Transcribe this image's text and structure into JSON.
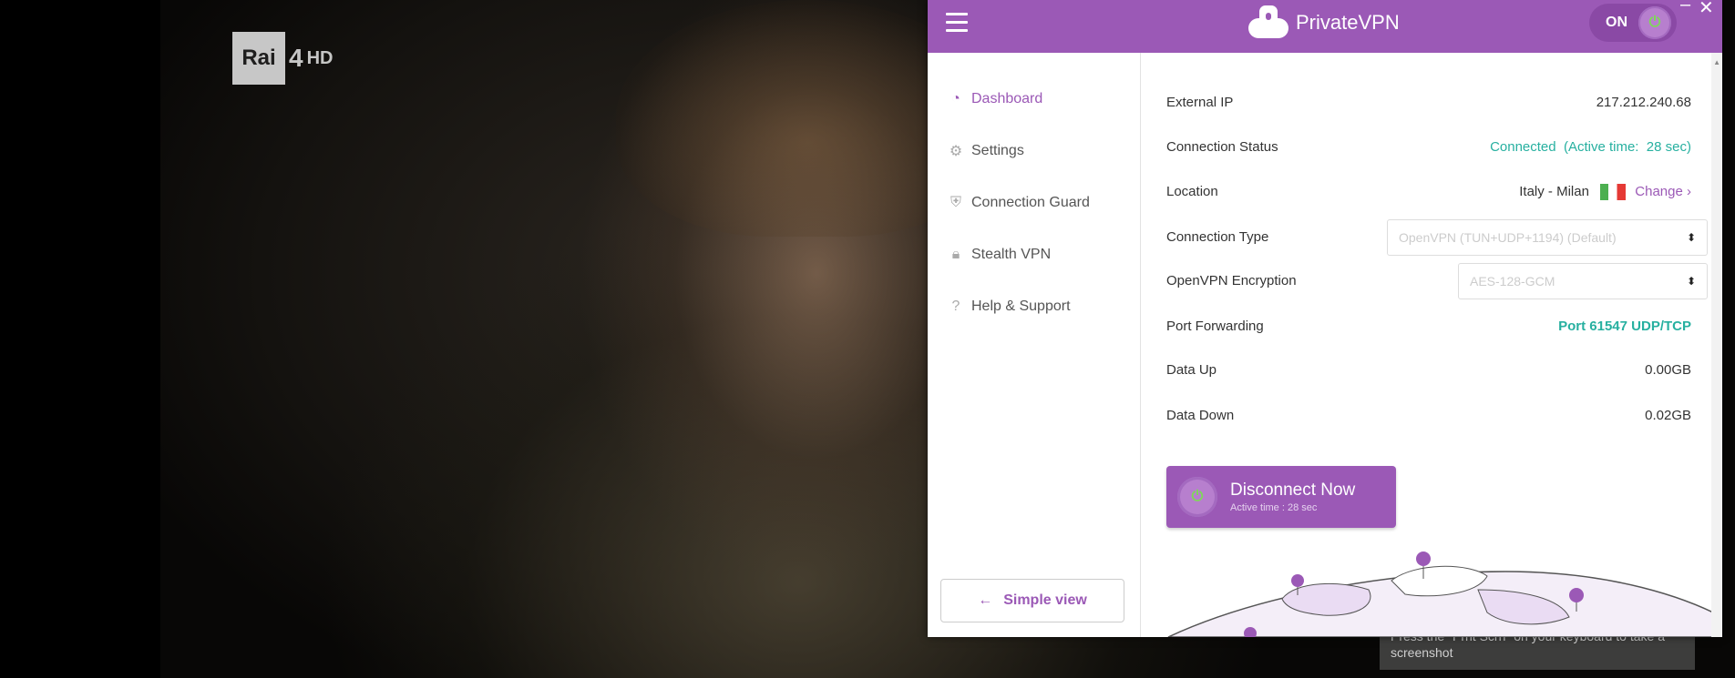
{
  "channel": {
    "name": "Rai",
    "number": "4",
    "suffix": "HD"
  },
  "app": {
    "brand": "PrivateVPN",
    "toggle_label": "ON",
    "minimize": "–",
    "close": "✕"
  },
  "sidebar": {
    "items": [
      {
        "label": "Dashboard",
        "icon": "gauge-icon"
      },
      {
        "label": "Settings",
        "icon": "gear-icon"
      },
      {
        "label": "Connection Guard",
        "icon": "shield-icon"
      },
      {
        "label": "Stealth VPN",
        "icon": "lock-icon"
      },
      {
        "label": "Help & Support",
        "icon": "question-icon"
      }
    ],
    "simple_view": "Simple view"
  },
  "dashboard": {
    "external_ip": {
      "label": "External IP",
      "value": "217.212.240.68"
    },
    "connection_status": {
      "label": "Connection Status",
      "value": "Connected  (Active time:  28 sec)"
    },
    "location": {
      "label": "Location",
      "value": "Italy - Milan",
      "change": "Change ›"
    },
    "connection_type": {
      "label": "Connection Type",
      "value": "OpenVPN (TUN+UDP+1194) (Default)"
    },
    "encryption": {
      "label": "OpenVPN Encryption",
      "value": "AES-128-GCM"
    },
    "port_forwarding": {
      "label": "Port Forwarding",
      "value": "Port 61547 UDP/TCP"
    },
    "data_up": {
      "label": "Data Up",
      "value": "0.00GB"
    },
    "data_down": {
      "label": "Data Down",
      "value": "0.02GB"
    },
    "disconnect": {
      "title": "Disconnect Now",
      "subtitle": "Active time :  28 sec"
    }
  },
  "toast": {
    "text": "Press the \"Prnt Scrn\" on your keyboard to take a screenshot"
  },
  "colors": {
    "accent": "#9b59b6",
    "status_green": "#27b0a0"
  }
}
